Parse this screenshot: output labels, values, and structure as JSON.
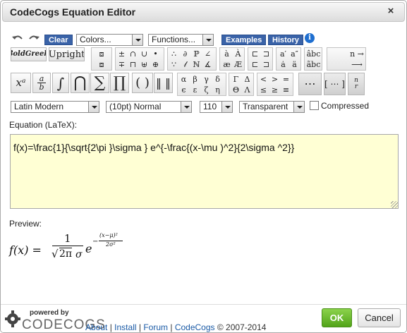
{
  "window": {
    "title": "CodeCogs Equation Editor",
    "close_glyph": "×"
  },
  "toolbar": {
    "clear_label": "Clear",
    "colors_value": "Colors...",
    "functions_value": "Functions...",
    "examples_label": "Examples",
    "history_label": "History",
    "info_glyph": "i",
    "bold_greek_label": "βoldGreek",
    "upright_label": "Upright"
  },
  "symbols": {
    "ops1": [
      "±",
      "∩",
      "∪",
      "•"
    ],
    "ops2": [
      "∓",
      "⊓",
      "⊎",
      "⊕"
    ],
    "dots1": [
      "∴",
      "∂",
      "ℙ",
      "∠"
    ],
    "dots2": [
      "∵",
      "𝓁",
      "ℕ",
      "∡"
    ],
    "accents1": [
      "à",
      "À"
    ],
    "accents2": [
      "æ",
      "Æ"
    ],
    "primes": [
      "a′",
      "a″"
    ],
    "arrow_right": "n →",
    "long_arrow": "⟶",
    "large": {
      "power": "xᵃ",
      "frac_num": "a",
      "frac_den": "b",
      "integral": "∫",
      "bigcap": "⋂",
      "sum": "∑",
      "prod": "∏",
      "paren": "( )",
      "norm": "‖ ‖"
    },
    "greek1": [
      "α",
      "β",
      "γ",
      "δ"
    ],
    "greek2": [
      "ϵ",
      "ε",
      "ζ",
      "η"
    ],
    "Greek1": [
      "Γ",
      "Δ"
    ],
    "Greek2": [
      "Θ",
      "Λ"
    ],
    "rel1": [
      "<",
      ">",
      "="
    ],
    "rel2": [
      "≤",
      "≥",
      "≡"
    ],
    "dots_cell": "⋯",
    "matrix": "[ ⋯ ]",
    "binom_top": "n",
    "binom_bot": "r"
  },
  "options": {
    "font_value": "Latin Modern",
    "size_value": "(10pt) Normal",
    "dpi_value": "110",
    "bg_value": "Transparent",
    "compressed_label": "Compressed"
  },
  "equation": {
    "label": "Equation (LaTeX):",
    "latex": "f(x)=\\frac{1}{\\sqrt{2\\pi }\\sigma } e^{-\\frac{(x-\\mu )^2}{2\\sigma ^2}}"
  },
  "preview": {
    "label": "Preview:",
    "lhs": "f(x) =",
    "num": "1",
    "den_root": "√",
    "den_body": "2π",
    "den_sigma": "σ",
    "base": "e",
    "exp_sign": "−",
    "exp_num": "(x−μ)²",
    "exp_den": "2σ²"
  },
  "footer": {
    "powered_by": "powered by",
    "brand": "CODECOGS",
    "links": [
      {
        "label": "About"
      },
      {
        "label": "Install"
      },
      {
        "label": "Forum"
      },
      {
        "label": "CodeCogs"
      }
    ],
    "separator": "|",
    "copyright": "© 2007-2014",
    "ok_label": "OK",
    "cancel_label": "Cancel"
  }
}
